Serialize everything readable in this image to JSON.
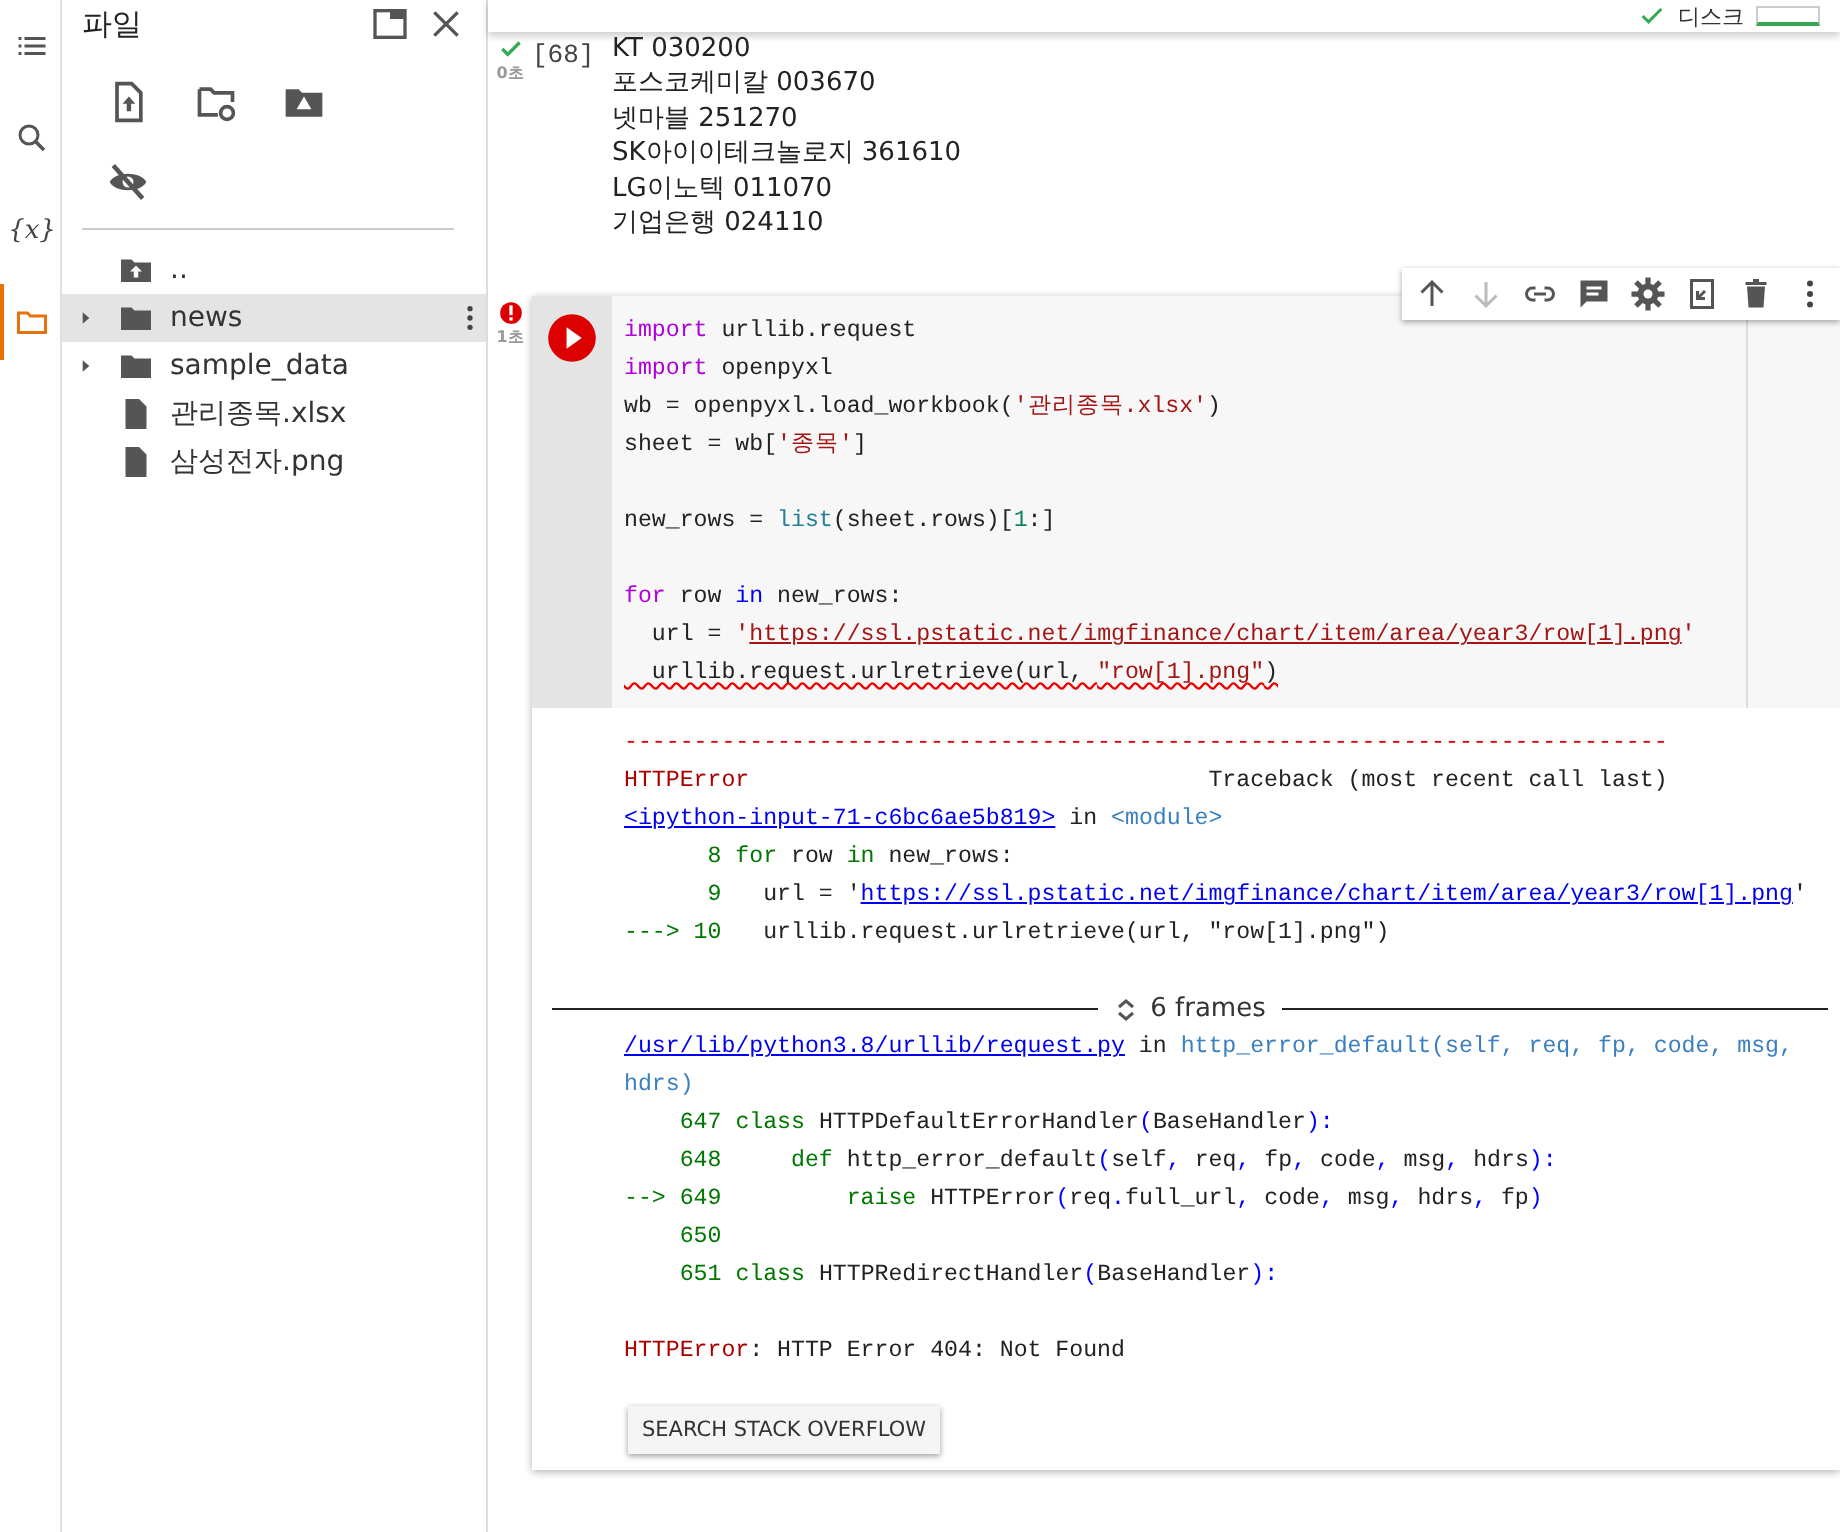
{
  "rail": [
    {
      "selected": false
    },
    {
      "selected": false
    },
    {
      "selected": false,
      "text": "{x}"
    },
    {
      "selected": true
    }
  ],
  "files": {
    "title": "파일",
    "tree": [
      {
        "kind": "parent",
        "label": "..",
        "selected": false
      },
      {
        "kind": "folder",
        "label": "news",
        "selected": true,
        "expanded": false
      },
      {
        "kind": "folder",
        "label": "sample_data",
        "selected": false,
        "expanded": false
      },
      {
        "kind": "file",
        "label": "관리종목.xlsx",
        "selected": false
      },
      {
        "kind": "file",
        "label": "삼성전자.png",
        "selected": false
      }
    ]
  },
  "toolbar": {
    "disk_label": "디스크"
  },
  "cells": [
    {
      "kind": "output",
      "failed": false,
      "time": "0초",
      "count": "[68]",
      "lines": [
        "KT 030200",
        "포스코케미칼 003670",
        "넷마블 251270",
        "SK아이이테크놀로지 361610",
        "LG이노텍 011070",
        "기업은행 024110"
      ]
    },
    {
      "kind": "code",
      "failed": true,
      "time": "1초",
      "code_blocks": [
        {
          "lines": [
            {
              "tokens": [
                {
                  "kind": "kw",
                  "text": "import"
                },
                {
                  "kind": "p",
                  "text": " urllib.request"
                }
              ]
            },
            {
              "tokens": [
                {
                  "kind": "kw",
                  "text": "import"
                },
                {
                  "kind": "p",
                  "text": " openpyxl"
                }
              ]
            },
            {
              "tokens": [
                {
                  "kind": "p",
                  "text": "wb = openpyxl.load_workbook("
                },
                {
                  "kind": "str",
                  "text": "'관리종목.xlsx'"
                },
                {
                  "kind": "p",
                  "text": ")"
                }
              ]
            },
            {
              "tokens": [
                {
                  "kind": "p",
                  "text": "sheet = wb["
                },
                {
                  "kind": "str",
                  "text": "'종목'"
                },
                {
                  "kind": "p",
                  "text": "]"
                }
              ]
            }
          ]
        },
        {
          "lines": [
            {
              "tokens": [
                {
                  "kind": "p",
                  "text": "new_rows = "
                },
                {
                  "kind": "fn",
                  "text": "list"
                },
                {
                  "kind": "p",
                  "text": "(sheet.rows)["
                },
                {
                  "kind": "num",
                  "text": "1"
                },
                {
                  "kind": "p",
                  "text": ":]"
                }
              ]
            }
          ]
        },
        {
          "lines": [
            {
              "tokens": [
                {
                  "kind": "kw",
                  "text": "for"
                },
                {
                  "kind": "p",
                  "text": " row "
                },
                {
                  "kind": "kw2",
                  "text": "in"
                },
                {
                  "kind": "p",
                  "text": " new_rows:"
                }
              ]
            },
            {
              "tokens": [
                {
                  "kind": "p",
                  "text": "  url = "
                },
                {
                  "kind": "str",
                  "text": "'"
                },
                {
                  "kind": "strlink",
                  "text": "https://ssl.pstatic.net/imgfinance/chart/item/area/year3/row[1].png"
                },
                {
                  "kind": "str",
                  "text": "'"
                }
              ]
            },
            {
              "tokens": [
                {
                  "kind": "squig",
                  "text": "  urllib.request.urlretrieve(url, "
                },
                {
                  "kind": "squigstr",
                  "text": "\"row[1].png\""
                },
                {
                  "kind": "squig",
                  "text": ")"
                }
              ]
            }
          ]
        }
      ],
      "output_blocks": [
        {
          "lines": [
            {
              "tokens": [
                {
                  "kind": "dash",
                  "text": "---------------------------------------------------------------------------"
                }
              ]
            },
            {
              "tokens": [
                {
                  "kind": "err",
                  "text": "HTTPError"
                },
                {
                  "kind": "p",
                  "text": "                                 Traceback (most recent call last)"
                }
              ]
            },
            {
              "tokens": [
                {
                  "kind": "link",
                  "text": "<ipython-input-71-c6bc6ae5b819>"
                },
                {
                  "kind": "p",
                  "text": " in "
                },
                {
                  "kind": "mod",
                  "text": "<module>"
                }
              ]
            },
            {
              "tokens": [
                {
                  "kind": "ln",
                  "text": "      8 "
                },
                {
                  "kind": "tkw",
                  "text": "for"
                },
                {
                  "kind": "p",
                  "text": " row "
                },
                {
                  "kind": "tkw",
                  "text": "in"
                },
                {
                  "kind": "p",
                  "text": " new_rows:"
                }
              ]
            },
            {
              "tokens": [
                {
                  "kind": "ln",
                  "text": "      9 "
                },
                {
                  "kind": "p",
                  "text": "  url = '"
                },
                {
                  "kind": "link",
                  "text": "https://ssl.pstatic.net/imgfinance/chart/item/area/year3/row[1].png"
                },
                {
                  "kind": "p",
                  "text": "'"
                }
              ]
            },
            {
              "tokens": [
                {
                  "kind": "ln",
                  "text": "---> 10 "
                },
                {
                  "kind": "p",
                  "text": "  urllib.request.urlretrieve(url, \"row[1].png\")"
                }
              ]
            }
          ]
        },
        {
          "lines": [
            {
              "kind": "frames",
              "text": "6 frames"
            },
            {
              "tokens": [
                {
                  "kind": "link",
                  "text": "/usr/lib/python3.8/urllib/request.py"
                },
                {
                  "kind": "p",
                  "text": " in "
                },
                {
                  "kind": "mod",
                  "text": "http_error_default(self, req, fp, code, msg, hdrs)"
                }
              ]
            },
            {
              "tokens": [
                {
                  "kind": "ln",
                  "text": "    647 "
                },
                {
                  "kind": "tkw",
                  "text": "class"
                },
                {
                  "kind": "p",
                  "text": " HTTPDefaultErrorHandler"
                },
                {
                  "kind": "bl",
                  "text": "("
                },
                {
                  "kind": "p",
                  "text": "BaseHandler"
                },
                {
                  "kind": "bl",
                  "text": "):"
                }
              ]
            },
            {
              "tokens": [
                {
                  "kind": "ln",
                  "text": "    648 "
                },
                {
                  "kind": "tkw",
                  "text": "    def"
                },
                {
                  "kind": "p",
                  "text": " http_error_default"
                },
                {
                  "kind": "bl",
                  "text": "("
                },
                {
                  "kind": "p",
                  "text": "self"
                },
                {
                  "kind": "bl",
                  "text": ","
                },
                {
                  "kind": "p",
                  "text": " req"
                },
                {
                  "kind": "bl",
                  "text": ","
                },
                {
                  "kind": "p",
                  "text": " fp"
                },
                {
                  "kind": "bl",
                  "text": ","
                },
                {
                  "kind": "p",
                  "text": " code"
                },
                {
                  "kind": "bl",
                  "text": ","
                },
                {
                  "kind": "p",
                  "text": " msg"
                },
                {
                  "kind": "bl",
                  "text": ","
                },
                {
                  "kind": "p",
                  "text": " hdrs"
                },
                {
                  "kind": "bl",
                  "text": "):"
                }
              ]
            },
            {
              "tokens": [
                {
                  "kind": "ln",
                  "text": "--> 649 "
                },
                {
                  "kind": "tkw",
                  "text": "        raise"
                },
                {
                  "kind": "p",
                  "text": " HTTPError"
                },
                {
                  "kind": "bl",
                  "text": "("
                },
                {
                  "kind": "p",
                  "text": "req"
                },
                {
                  "kind": "bl",
                  "text": "."
                },
                {
                  "kind": "p",
                  "text": "full_url"
                },
                {
                  "kind": "bl",
                  "text": ","
                },
                {
                  "kind": "p",
                  "text": " code"
                },
                {
                  "kind": "bl",
                  "text": ","
                },
                {
                  "kind": "p",
                  "text": " msg"
                },
                {
                  "kind": "bl",
                  "text": ","
                },
                {
                  "kind": "p",
                  "text": " hdrs"
                },
                {
                  "kind": "bl",
                  "text": ","
                },
                {
                  "kind": "p",
                  "text": " fp"
                },
                {
                  "kind": "bl",
                  "text": ")"
                }
              ]
            },
            {
              "tokens": [
                {
                  "kind": "ln",
                  "text": "    650"
                }
              ]
            },
            {
              "tokens": [
                {
                  "kind": "ln",
                  "text": "    651 "
                },
                {
                  "kind": "tkw",
                  "text": "class"
                },
                {
                  "kind": "p",
                  "text": " HTTPRedirectHandler"
                },
                {
                  "kind": "bl",
                  "text": "("
                },
                {
                  "kind": "p",
                  "text": "BaseHandler"
                },
                {
                  "kind": "bl",
                  "text": "):"
                }
              ]
            }
          ]
        },
        {
          "lines": [
            {
              "tokens": [
                {
                  "kind": "err",
                  "text": "HTTPError"
                },
                {
                  "kind": "p",
                  "text": ": HTTP Error 404: Not Found"
                }
              ]
            }
          ]
        }
      ],
      "button": "SEARCH STACK OVERFLOW"
    }
  ]
}
